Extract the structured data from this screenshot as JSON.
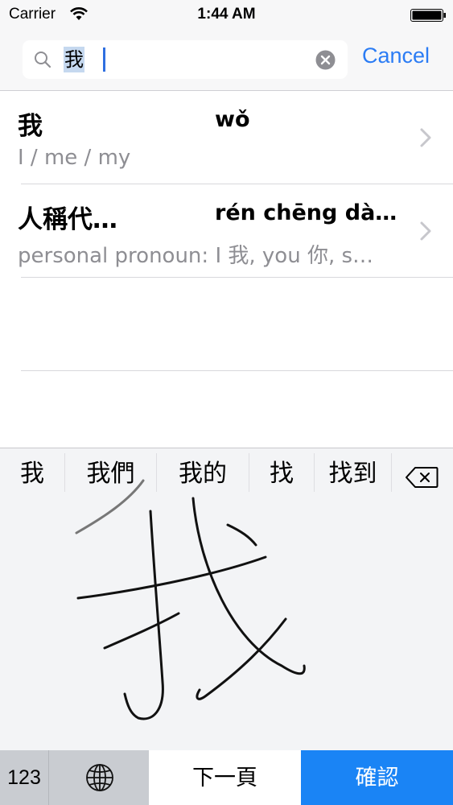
{
  "status_bar": {
    "carrier": "Carrier",
    "time": "1:44 AM",
    "wifi_icon": "wifi-icon",
    "battery_icon": "battery-icon"
  },
  "search": {
    "value": "我",
    "icon": "search-icon",
    "clear_icon": "clear-icon",
    "cancel_label": "Cancel",
    "accent_color": "#2b7cf4"
  },
  "results": [
    {
      "hanzi": "我",
      "pinyin": "wǒ",
      "definition": "I / me / my"
    },
    {
      "hanzi": "人稱代…",
      "pinyin": "rén chēng dà…",
      "definition": "personal pronoun: I 我, you 你, s…"
    }
  ],
  "keyboard": {
    "candidates": [
      "我",
      "我們",
      "我的",
      "找",
      "找到"
    ],
    "backspace_icon": "backspace-icon",
    "numbers_key": "123",
    "globe_icon": "globe-icon",
    "next_page_key": "下一頁",
    "confirm_key": "確認",
    "confirm_color": "#1a84f5",
    "handwritten_character": "我"
  }
}
